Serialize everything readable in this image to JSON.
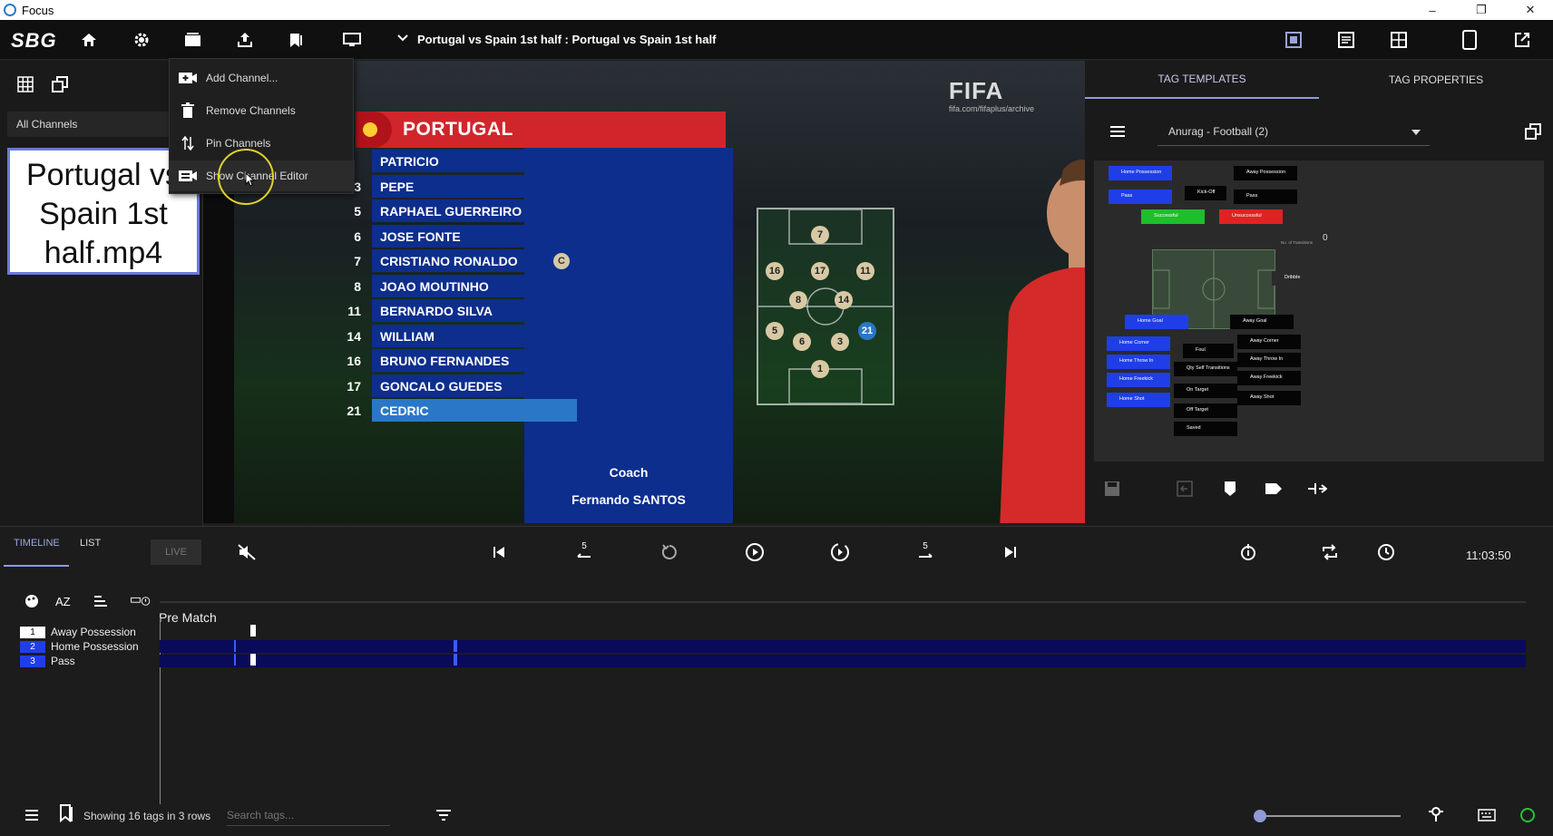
{
  "window": {
    "title": "Focus"
  },
  "toolbar": {
    "logo": "SBG",
    "session_title": "Portugal vs Spain 1st half : Portugal vs Spain 1st half"
  },
  "channels": {
    "filter_label": "All Channels",
    "card_title": "Portugal vs Spain 1st half.mp4"
  },
  "context_menu": {
    "items": [
      {
        "label": "Add Channel...",
        "icon": "add-video-icon"
      },
      {
        "label": "Remove Channels",
        "icon": "trash-icon"
      },
      {
        "label": "Pin Channels",
        "icon": "sort-icon"
      },
      {
        "label": "Show Channel Editor",
        "icon": "video-editor-icon"
      }
    ],
    "hovered_index": 3
  },
  "video": {
    "watermark": "FIFA",
    "watermark_sub": "fifa.com/fifaplus/archive",
    "team": "PORTUGAL",
    "players": [
      {
        "number": "",
        "name": "PATRICIO"
      },
      {
        "number": "3",
        "name": "PEPE"
      },
      {
        "number": "5",
        "name": "RAPHAEL GUERREIRO"
      },
      {
        "number": "6",
        "name": "JOSE FONTE"
      },
      {
        "number": "7",
        "name": "CRISTIANO RONALDO",
        "captain": "C"
      },
      {
        "number": "8",
        "name": "JOAO MOUTINHO"
      },
      {
        "number": "11",
        "name": "BERNARDO SILVA"
      },
      {
        "number": "14",
        "name": "WILLIAM"
      },
      {
        "number": "16",
        "name": "BRUNO FERNANDES"
      },
      {
        "number": "17",
        "name": "GONCALO GUEDES"
      },
      {
        "number": "21",
        "name": "CEDRIC",
        "selected": true
      }
    ],
    "coach_label": "Coach",
    "coach_name": "Fernando SANTOS",
    "formation": [
      "7",
      "16",
      "17",
      "11",
      "8",
      "14",
      "5",
      "6",
      "3",
      "21",
      "1"
    ]
  },
  "tag_panel": {
    "tabs": [
      "TAG TEMPLATES",
      "TAG PROPERTIES"
    ],
    "active_tab": "TAG TEMPLATES",
    "template": "Anurag - Football (2)",
    "buttons": [
      {
        "label": "Home Possession",
        "color": "#1f3ee8"
      },
      {
        "label": "Away Possession",
        "color": "#050505"
      },
      {
        "label": "Kick-Off",
        "color": "#050505"
      },
      {
        "label": "Pass",
        "color": "#1f3ee8"
      },
      {
        "label": "Pass",
        "color": "#050505"
      },
      {
        "label": "Successful",
        "color": "#1cbf2a"
      },
      {
        "label": "Unsuccessful",
        "color": "#e02222"
      },
      {
        "label": "Dribble",
        "color": "#2a2a2a"
      },
      {
        "label": "Home Goal",
        "color": "#1f3ee8"
      },
      {
        "label": "Away Goal",
        "color": "#050505"
      },
      {
        "label": "Home Corner",
        "color": "#1f3ee8"
      },
      {
        "label": "Foul",
        "color": "#050505"
      },
      {
        "label": "Away Corner",
        "color": "#050505"
      },
      {
        "label": "Home Throw In",
        "color": "#1f3ee8"
      },
      {
        "label": "Qty Self Transitions",
        "color": "#050505"
      },
      {
        "label": "Away Throw In",
        "color": "#050505"
      },
      {
        "label": "Home Freekick",
        "color": "#1f3ee8"
      },
      {
        "label": "On Target",
        "color": "#050505"
      },
      {
        "label": "Away Freekick",
        "color": "#050505"
      },
      {
        "label": "Home Shot",
        "color": "#1f3ee8"
      },
      {
        "label": "Off Target",
        "color": "#050505"
      },
      {
        "label": "Away Shot",
        "color": "#050505"
      },
      {
        "label": "Saved",
        "color": "#050505"
      }
    ],
    "counter": "0",
    "counter_label": "No. of Transitions"
  },
  "timeline": {
    "tabs": [
      "TIMELINE",
      "LIST"
    ],
    "active_tab": "TIMELINE",
    "live_label": "LIVE",
    "skip_back_label": "5",
    "skip_fwd_label": "5",
    "clock": "11:03:50",
    "period_label": "Pre Match",
    "rows": [
      {
        "num": "1",
        "label": "Away Possession",
        "badge_color": "#ffffff"
      },
      {
        "num": "2",
        "label": "Home Possession",
        "badge_color": "#1f3ee8"
      },
      {
        "num": "3",
        "label": "Pass",
        "badge_color": "#1f3ee8"
      }
    ],
    "status": "Showing 16 tags in 3 rows",
    "search_placeholder": "Search tags...",
    "zoom_level": 0.05
  }
}
